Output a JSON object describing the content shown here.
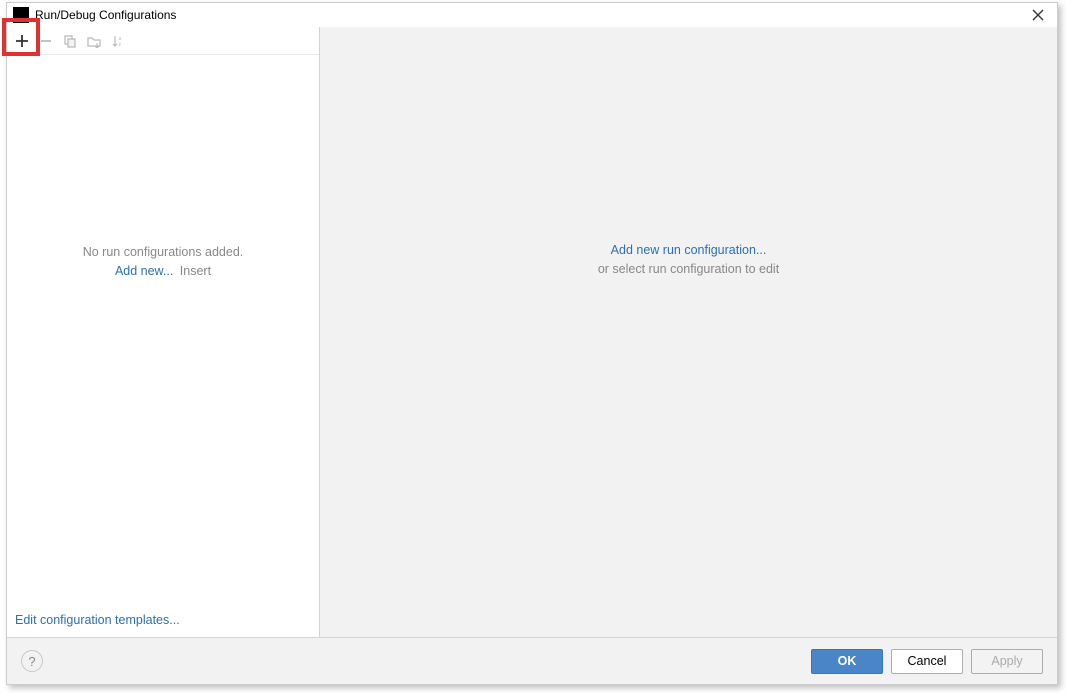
{
  "titlebar": {
    "title": "Run/Debug Configurations"
  },
  "left": {
    "empty_msg": "No run configurations added.",
    "add_link": "Add new...",
    "add_hint": "Insert",
    "edit_templates": "Edit configuration templates..."
  },
  "right": {
    "add_link": "Add new run configuration...",
    "sub": "or select run configuration to edit"
  },
  "buttons": {
    "ok": "OK",
    "cancel": "Cancel",
    "apply": "Apply",
    "help": "?"
  }
}
